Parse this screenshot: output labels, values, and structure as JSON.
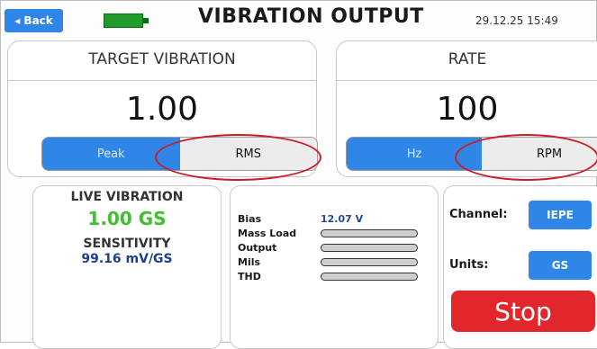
{
  "header": {
    "back_label": "◂ Back",
    "title": "VIBRATION OUTPUT",
    "datetime": "29.12.25 15:49",
    "battery_color": "#1f9b2a"
  },
  "target": {
    "title": "TARGET VIBRATION",
    "value": "1.00",
    "options": [
      "Peak",
      "RMS"
    ],
    "selected": "Peak"
  },
  "rate": {
    "title": "RATE",
    "value": "100",
    "options": [
      "Hz",
      "RPM"
    ],
    "selected": "Hz"
  },
  "live": {
    "label": "LIVE VIBRATION",
    "value": "1.00 GS",
    "sensitivity_label": "SENSITIVITY",
    "sensitivity_value": "99.16 mV/GS"
  },
  "measurements": {
    "bias_label": "Bias",
    "bias_value": "12.07 V",
    "mass_load_label": "Mass Load",
    "output_label": "Output",
    "mils_label": "Mils",
    "thd_label": "THD"
  },
  "controls": {
    "channel_label": "Channel:",
    "channel_value": "IEPE",
    "units_label": "Units:",
    "units_value": "GS",
    "stop_label": "Stop"
  },
  "colors": {
    "accent": "#2f86e6",
    "stop": "#e1262c",
    "live_value": "#3fc02f",
    "annotation": "#c81e2a"
  }
}
